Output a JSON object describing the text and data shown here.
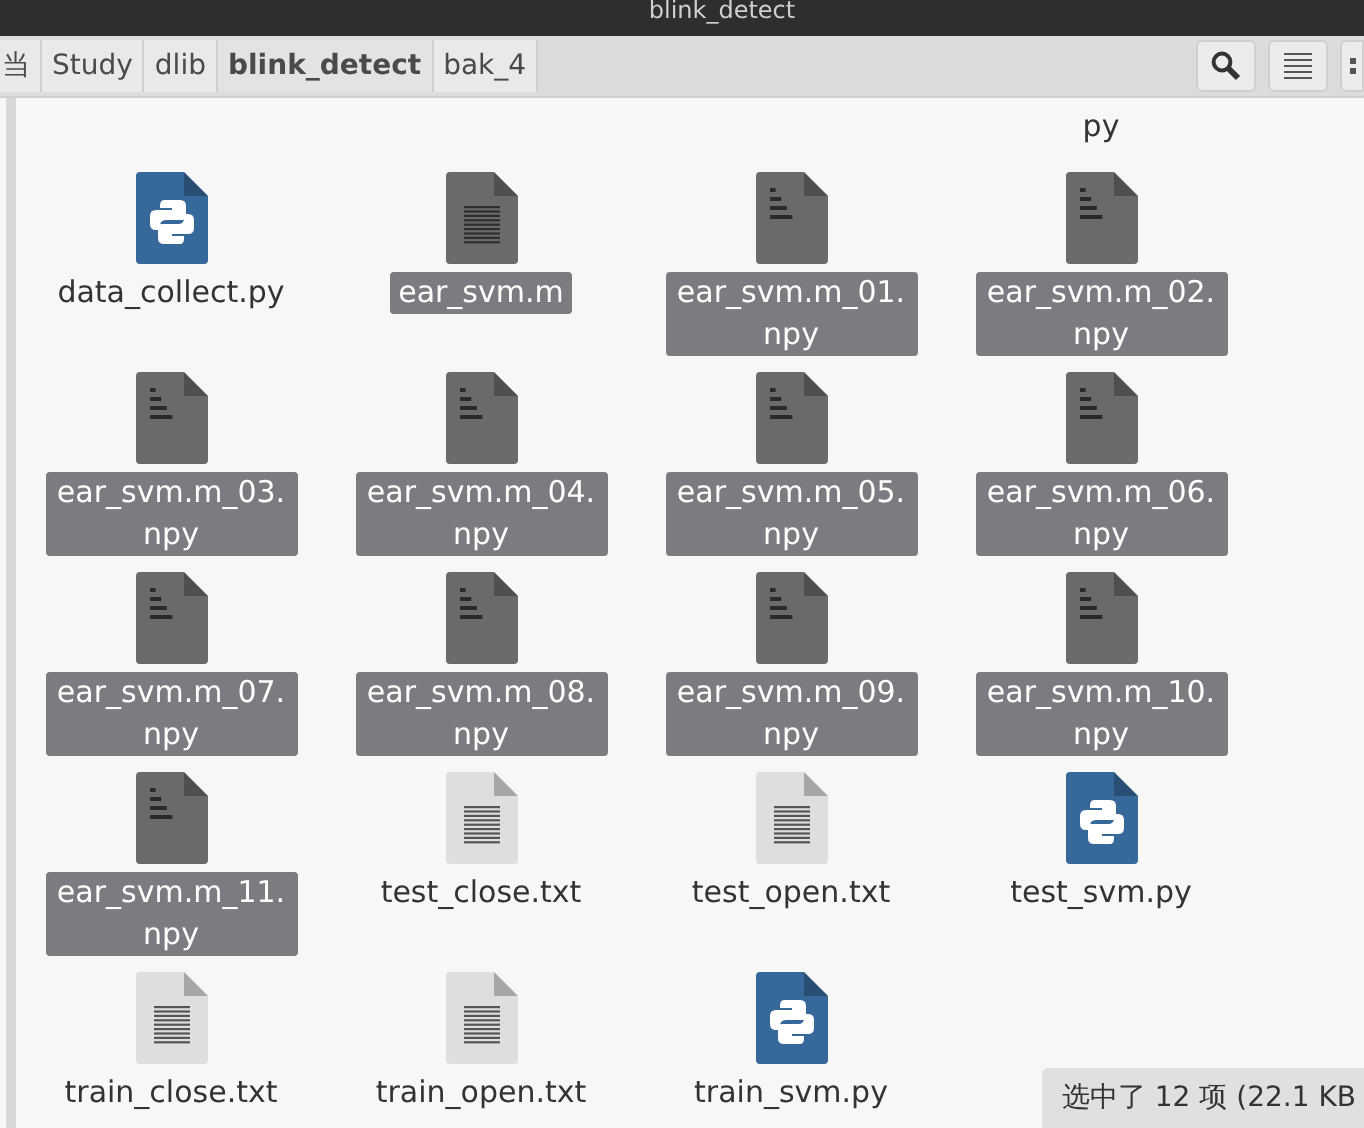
{
  "window": {
    "title": "blink_detect"
  },
  "path_bar": [
    {
      "label": "当",
      "selected": false
    },
    {
      "label": "Study",
      "selected": false
    },
    {
      "label": "dlib",
      "selected": false
    },
    {
      "label": "blink_detect",
      "selected": true
    },
    {
      "label": "bak_4",
      "selected": false
    }
  ],
  "cut_off_row": [
    {
      "text": "py"
    }
  ],
  "files": [
    {
      "name": "data_collect.py",
      "kind": "python",
      "selected": false
    },
    {
      "name": "ear_svm.m",
      "kind": "text",
      "selected": true
    },
    {
      "name": "ear_svm.m_01.npy",
      "kind": "binary",
      "selected": true
    },
    {
      "name": "ear_svm.m_02.npy",
      "kind": "binary",
      "selected": true
    },
    {
      "name": "ear_svm.m_03.npy",
      "kind": "binary",
      "selected": true
    },
    {
      "name": "ear_svm.m_04.npy",
      "kind": "binary",
      "selected": true
    },
    {
      "name": "ear_svm.m_05.npy",
      "kind": "binary",
      "selected": true
    },
    {
      "name": "ear_svm.m_06.npy",
      "kind": "binary",
      "selected": true
    },
    {
      "name": "ear_svm.m_07.npy",
      "kind": "binary",
      "selected": true
    },
    {
      "name": "ear_svm.m_08.npy",
      "kind": "binary",
      "selected": true
    },
    {
      "name": "ear_svm.m_09.npy",
      "kind": "binary",
      "selected": true
    },
    {
      "name": "ear_svm.m_10.npy",
      "kind": "binary",
      "selected": true
    },
    {
      "name": "ear_svm.m_11.npy",
      "kind": "binary",
      "selected": true
    },
    {
      "name": "test_close.txt",
      "kind": "text",
      "selected": false
    },
    {
      "name": "test_open.txt",
      "kind": "text",
      "selected": false
    },
    {
      "name": "test_svm.py",
      "kind": "python",
      "selected": false
    },
    {
      "name": "train_close.txt",
      "kind": "text",
      "selected": false
    },
    {
      "name": "train_open.txt",
      "kind": "text",
      "selected": false
    },
    {
      "name": "train_svm.py",
      "kind": "python",
      "selected": false
    }
  ],
  "status_bar": {
    "text": "选中了 12 项 (22.1 KB"
  }
}
